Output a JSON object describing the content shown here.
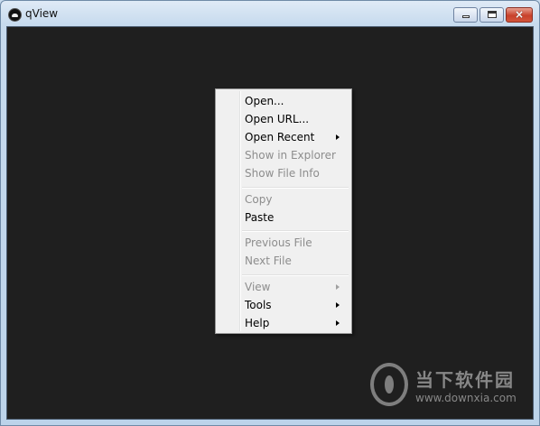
{
  "window": {
    "title": "qView",
    "controls": {
      "minimize": "minimize-icon",
      "maximize": "maximize-icon",
      "close": "×"
    }
  },
  "context_menu": {
    "items": [
      {
        "label": "Open...",
        "enabled": true,
        "submenu": false
      },
      {
        "label": "Open URL...",
        "enabled": true,
        "submenu": false
      },
      {
        "label": "Open Recent",
        "enabled": true,
        "submenu": true
      },
      {
        "label": "Show in Explorer",
        "enabled": false,
        "submenu": false
      },
      {
        "label": "Show File Info",
        "enabled": false,
        "submenu": false
      },
      {
        "label": "Copy",
        "enabled": false,
        "submenu": false
      },
      {
        "label": "Paste",
        "enabled": true,
        "submenu": false
      },
      {
        "label": "Previous File",
        "enabled": false,
        "submenu": false
      },
      {
        "label": "Next File",
        "enabled": false,
        "submenu": false
      },
      {
        "label": "View",
        "enabled": false,
        "submenu": true
      },
      {
        "label": "Tools",
        "enabled": true,
        "submenu": true
      },
      {
        "label": "Help",
        "enabled": true,
        "submenu": true
      }
    ]
  },
  "watermark": {
    "title": "当下软件园",
    "url": "www.downxia.com"
  },
  "colors": {
    "canvas_bg": "#1f1f1f",
    "menu_bg": "#f0f0f0",
    "disabled_text": "#8d8d8d"
  }
}
